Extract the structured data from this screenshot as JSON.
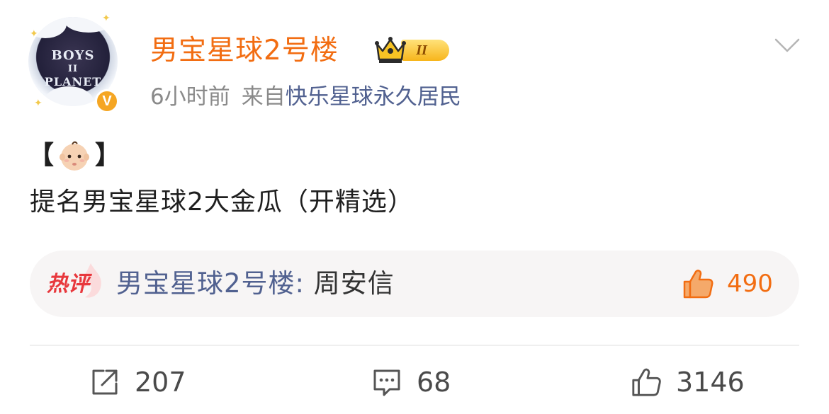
{
  "post": {
    "username": "男宝星球2号楼",
    "member_level": "II",
    "time": "6小时前",
    "from_label": "来自",
    "source": "快乐星球永久居民",
    "content": {
      "bracket_open": "【",
      "bracket_close": "】",
      "text": "提名男宝星球2大金瓜（开精选）"
    },
    "avatar": {
      "top_text": "BOYS",
      "mid_text": "II",
      "bottom_text": "PLANET",
      "verified_text": "V"
    },
    "hot_comment": {
      "label": "热评",
      "author": "男宝星球2号楼",
      "separator": ": ",
      "text": "周安信",
      "likes": "490"
    },
    "actions": {
      "reposts": "207",
      "comments": "68",
      "likes": "3146"
    }
  },
  "colors": {
    "username": "#f26d12",
    "link_blue": "#516190",
    "hot_red": "#e8383d",
    "meta_gray": "#8a8a8a"
  }
}
